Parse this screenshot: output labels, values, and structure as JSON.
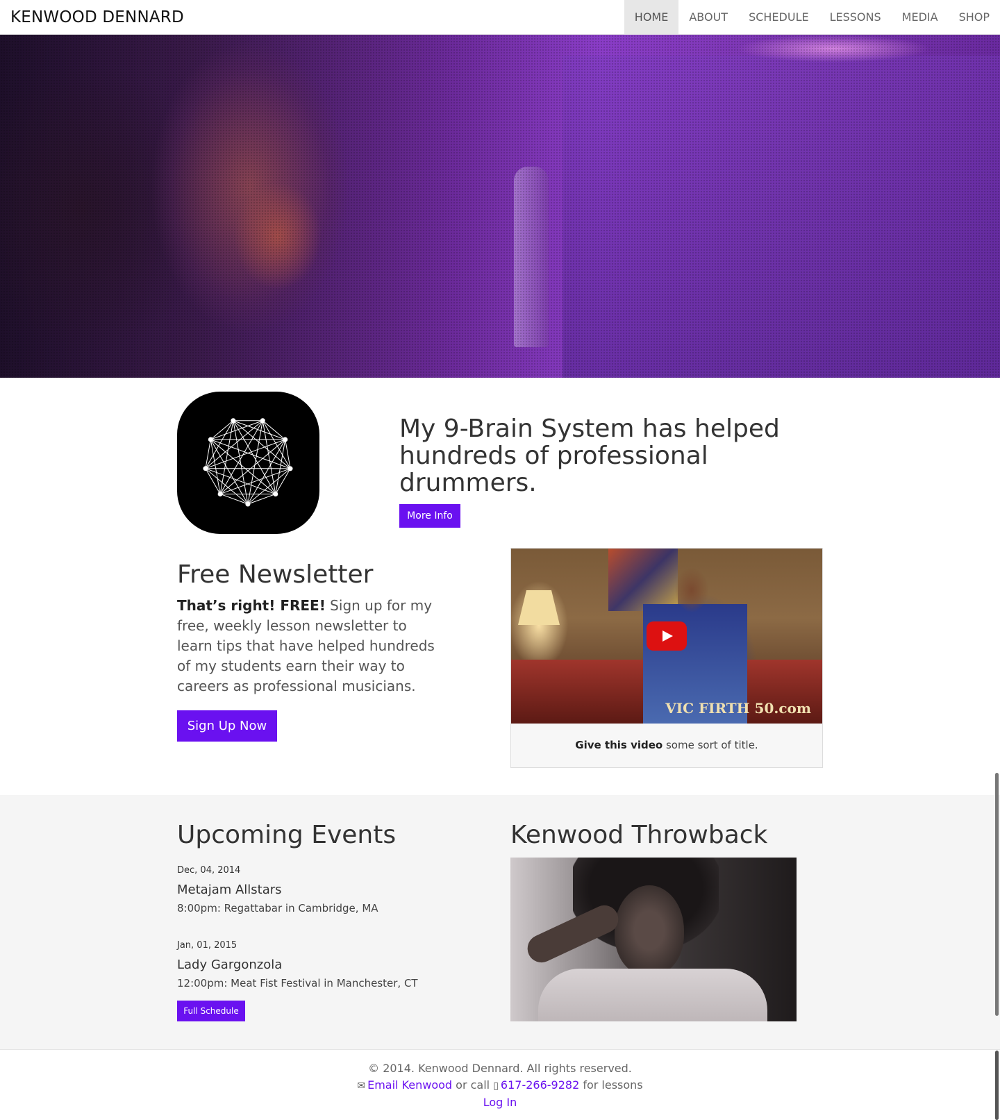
{
  "nav": {
    "brand": "KENWOOD DENNARD",
    "items": [
      "HOME",
      "ABOUT",
      "SCHEDULE",
      "LESSONS",
      "MEDIA",
      "SHOP"
    ],
    "active": "HOME"
  },
  "feature": {
    "tagline": "My 9-Brain System has helped hundreds of professional drummers.",
    "button": "More Info"
  },
  "newsletter": {
    "title": "Free Newsletter",
    "lead": "That’s right! FREE!",
    "body": " Sign up for my free, weekly lesson newsletter to learn tips that have helped hundreds of my students earn their way to careers as professional musicians.",
    "button": "Sign Up Now"
  },
  "video": {
    "watermark": "VIC FIRTH 50.com",
    "caption_bold": "Give this video",
    "caption_rest": " some sort of title."
  },
  "events": {
    "title": "Upcoming Events",
    "items": [
      {
        "date": "Dec, 04, 2014",
        "name": "Metajam Allstars",
        "detail": "8:00pm: Regattabar in Cambridge, MA"
      },
      {
        "date": "Jan, 01, 2015",
        "name": "Lady Gargonzola",
        "detail": "12:00pm: Meat Fist Festival in Manchester, CT"
      }
    ],
    "button": "Full Schedule"
  },
  "throwback": {
    "title": "Kenwood Throwback"
  },
  "footer": {
    "copyright": "© 2014. Kenwood Dennard. All rights reserved.",
    "email_link": "Email Kenwood",
    "or_call": " or call ",
    "phone": "617-266-9282",
    "for_lessons": " for lessons",
    "login": "Log In"
  },
  "colors": {
    "accent": "#6a11f0",
    "band": "#f5f5f5",
    "nav_active": "#e7e7e7"
  }
}
